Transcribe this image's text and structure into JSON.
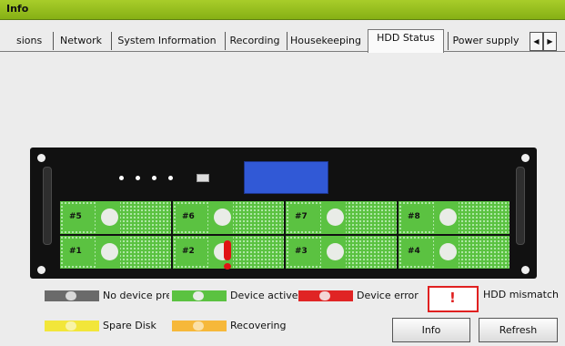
{
  "window": {
    "title": "Info"
  },
  "tabs": [
    {
      "label": "sions",
      "active": false
    },
    {
      "label": "Network",
      "active": false
    },
    {
      "label": "System Information",
      "active": false
    },
    {
      "label": "Recording",
      "active": false
    },
    {
      "label": "Housekeeping",
      "active": false
    },
    {
      "label": "HDD Status",
      "active": true
    },
    {
      "label": "Power supply",
      "active": false
    }
  ],
  "tab_scroll": {
    "left_icon": "◀",
    "right_icon": "▶"
  },
  "bays": [
    {
      "label": "#5",
      "status": "active",
      "mismatch": false
    },
    {
      "label": "#6",
      "status": "active",
      "mismatch": false
    },
    {
      "label": "#7",
      "status": "active",
      "mismatch": false
    },
    {
      "label": "#8",
      "status": "active",
      "mismatch": false
    },
    {
      "label": "#1",
      "status": "active",
      "mismatch": false
    },
    {
      "label": "#2",
      "status": "active",
      "mismatch": true
    },
    {
      "label": "#3",
      "status": "active",
      "mismatch": false
    },
    {
      "label": "#4",
      "status": "active",
      "mismatch": false
    }
  ],
  "legend": {
    "no_device": "No device prese",
    "active": "Device active",
    "error": "Device error",
    "mismatch": "HDD mismatch",
    "mismatch_symbol": "!",
    "spare": "Spare Disk",
    "recovering": "Recovering"
  },
  "colors": {
    "active": "#5bc241",
    "no_device": "#6a6a6a",
    "error": "#e02424",
    "spare": "#f2e63a",
    "recovering": "#f6b83a",
    "mismatch": "#e01414",
    "titlebar": "#95c11f",
    "lcd": "#3159d6"
  },
  "buttons": {
    "info": "Info",
    "refresh": "Refresh"
  }
}
